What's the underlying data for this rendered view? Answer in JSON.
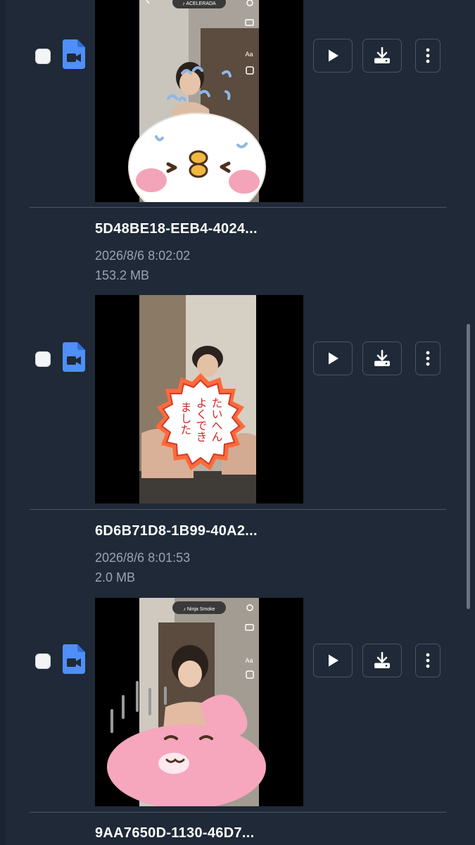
{
  "files": [
    {
      "name": "5D48BE18-EEB4-4024...",
      "date": "2026/8/6 8:02:02",
      "size": "153.2 MB",
      "thumbnail": {
        "music_chip": "♪ ACELERADA",
        "sticker": "chick-face-sticker"
      }
    },
    {
      "name": "6D6B71D8-1B99-40A2...",
      "date": "2026/8/6 8:01:53",
      "size": "2.0 MB",
      "thumbnail": {
        "stamp_lines": [
          "たいへん",
          "よくでき",
          "ました"
        ],
        "sticker": "flower-stamp"
      }
    },
    {
      "name": "9AA7650D-1130-46D7...",
      "date": "",
      "size": "",
      "thumbnail": {
        "music_chip": "♪ Ninja Smoke",
        "sticker": "pink-rabbit-sticker"
      }
    }
  ],
  "theme": {
    "background": "#1f2937",
    "accent_icon": "#4f8ff7",
    "button_border": "#4b5563",
    "text_primary": "#ffffff",
    "text_secondary": "#9ca3af"
  },
  "icons": {
    "row_checkbox": "checkbox",
    "file_type": "video-file-icon",
    "play": "play-icon",
    "download": "download-icon",
    "more": "kebab-menu-icon"
  }
}
